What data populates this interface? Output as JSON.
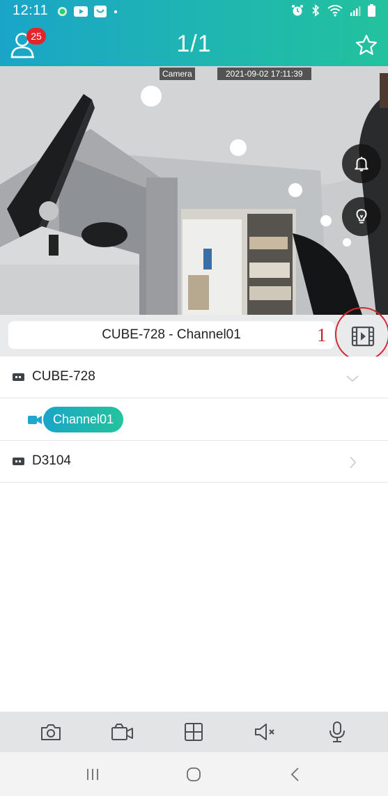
{
  "status_bar": {
    "time": "12:11",
    "left_icons": [
      "whatsapp-icon",
      "youtube-icon",
      "outlook-icon",
      "dot-icon"
    ],
    "right_icons": [
      "alarm-clock-icon",
      "bluetooth-icon",
      "wifi-icon",
      "signal-icon",
      "battery-icon"
    ]
  },
  "header": {
    "title": "1/1",
    "notification_count": "25",
    "gradient_start": "#1aa5c8",
    "gradient_end": "#22c29e"
  },
  "video": {
    "osd_camera": "Camera",
    "osd_timestamp": "2021-09-02 17:11:39",
    "buttons": [
      "bell-icon",
      "lightbulb-icon"
    ]
  },
  "channel_bar": {
    "selected_channel": "CUBE-728 - Channel01",
    "marker_number": "1",
    "marker_color": "#d5272c"
  },
  "device_list": {
    "devices": [
      {
        "name": "CUBE-728",
        "expanded": true,
        "channels": [
          {
            "name": "Channel01",
            "selected": true
          }
        ]
      },
      {
        "name": "D3104",
        "expanded": false,
        "channels": []
      }
    ]
  },
  "toolbar": {
    "items": [
      "snapshot-camera-icon",
      "record-video-icon",
      "grid-layout-icon",
      "speaker-mute-icon",
      "microphone-icon"
    ]
  },
  "system_nav": {
    "items": [
      "recent-apps-icon",
      "home-icon",
      "back-icon"
    ]
  }
}
